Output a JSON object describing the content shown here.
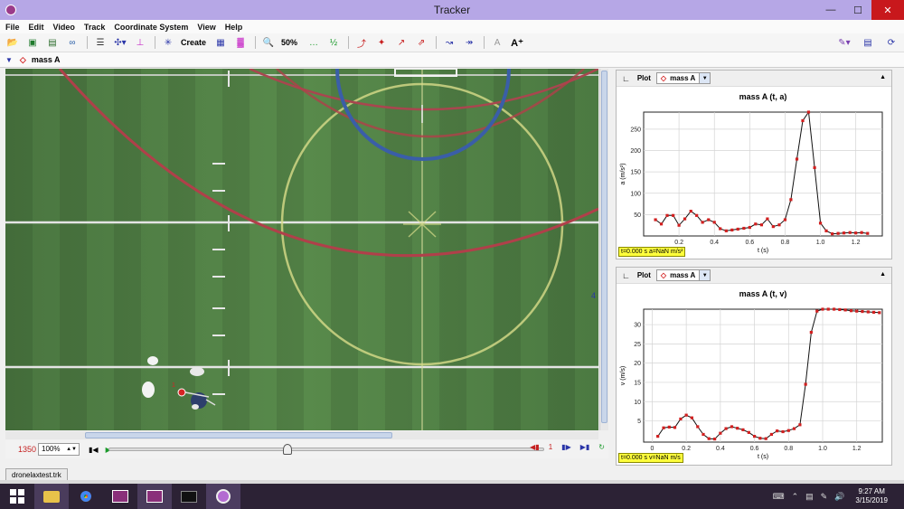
{
  "window": {
    "title": "Tracker"
  },
  "menu": [
    "File",
    "Edit",
    "Video",
    "Track",
    "Coordinate System",
    "View",
    "Help"
  ],
  "toolbar": {
    "create_label": "Create",
    "zoom_label": "50%"
  },
  "track_bar": {
    "track_name": "mass A"
  },
  "video_panel": {
    "edge_label": "4"
  },
  "player": {
    "frame": "1350",
    "zoom": "100%",
    "step": "1"
  },
  "file_tab": "dronelaxtest.trk",
  "plots": [
    {
      "header_label": "Plot",
      "track_select": "mass A",
      "readout": "t=0.000 s  a=NaN m/s²",
      "chart_data": {
        "type": "line",
        "title": "mass A (t, a)",
        "xlabel": "t (s)",
        "ylabel": "a (m/s²)",
        "xlim": [
          0,
          1.35
        ],
        "ylim": [
          0,
          290
        ],
        "x_ticks": [
          0.2,
          0.4,
          0.6,
          0.8,
          1.0,
          1.2
        ],
        "x_tick_labels": [
          "0.2",
          "0.4",
          "0.6",
          "0.8",
          "1.0",
          "1.2"
        ],
        "y_ticks": [
          50,
          100,
          150,
          200,
          250
        ],
        "y_tick_labels": [
          "50",
          "100",
          "150",
          "200",
          "250"
        ],
        "grid": true,
        "series": [
          {
            "x": [
              0.067,
              0.1,
              0.133,
              0.167,
              0.2,
              0.233,
              0.267,
              0.3,
              0.333,
              0.367,
              0.4,
              0.433,
              0.467,
              0.5,
              0.533,
              0.567,
              0.6,
              0.633,
              0.667,
              0.7,
              0.733,
              0.767,
              0.8,
              0.833,
              0.867,
              0.9,
              0.933,
              0.967,
              1.0,
              1.033,
              1.067,
              1.1,
              1.133,
              1.167,
              1.2,
              1.233,
              1.267
            ],
            "y": [
              38,
              28,
              48,
              48,
              25,
              40,
              58,
              48,
              32,
              38,
              32,
              17,
              12,
              14,
              16,
              18,
              20,
              28,
              26,
              40,
              22,
              26,
              38,
              85,
              180,
              270,
              290,
              160,
              30,
              12,
              5,
              6,
              7,
              8,
              7,
              8,
              6
            ]
          }
        ]
      }
    },
    {
      "header_label": "Plot",
      "track_select": "mass A",
      "readout": "t=0.000 s  v=NaN m/s",
      "chart_data": {
        "type": "line",
        "title": "mass A (t, v)",
        "xlabel": "t (s)",
        "ylabel": "v (m/s)",
        "xlim": [
          -0.05,
          1.35
        ],
        "ylim": [
          -0.5,
          34
        ],
        "x_ticks": [
          0,
          0.2,
          0.4,
          0.6,
          0.8,
          1.0,
          1.2
        ],
        "x_tick_labels": [
          "0",
          "0.2",
          "0.4",
          "0.6",
          "0.8",
          "1.0",
          "1.2"
        ],
        "y_ticks": [
          5,
          10,
          15,
          20,
          25,
          30
        ],
        "y_tick_labels": [
          "5",
          "10",
          "15",
          "20",
          "25",
          "30"
        ],
        "grid": true,
        "series": [
          {
            "x": [
              0.033,
              0.067,
              0.1,
              0.133,
              0.167,
              0.2,
              0.233,
              0.267,
              0.3,
              0.333,
              0.367,
              0.4,
              0.433,
              0.467,
              0.5,
              0.533,
              0.567,
              0.6,
              0.633,
              0.667,
              0.7,
              0.733,
              0.767,
              0.8,
              0.833,
              0.867,
              0.9,
              0.933,
              0.967,
              1.0,
              1.033,
              1.067,
              1.1,
              1.133,
              1.167,
              1.2,
              1.233,
              1.267,
              1.3,
              1.333
            ],
            "y": [
              1.0,
              3.2,
              3.4,
              3.3,
              5.5,
              6.5,
              5.8,
              3.5,
              1.5,
              0.4,
              0.3,
              1.8,
              3.0,
              3.5,
              3.1,
              2.7,
              2.0,
              1.0,
              0.5,
              0.4,
              1.5,
              2.4,
              2.2,
              2.5,
              3.0,
              4.0,
              14.5,
              28.0,
              33.5,
              34.0,
              34.0,
              34.0,
              33.9,
              33.8,
              33.6,
              33.5,
              33.4,
              33.3,
              33.2,
              33.1
            ]
          }
        ]
      }
    }
  ],
  "taskbar": {
    "time": "9:27 AM",
    "date": "3/15/2019"
  }
}
